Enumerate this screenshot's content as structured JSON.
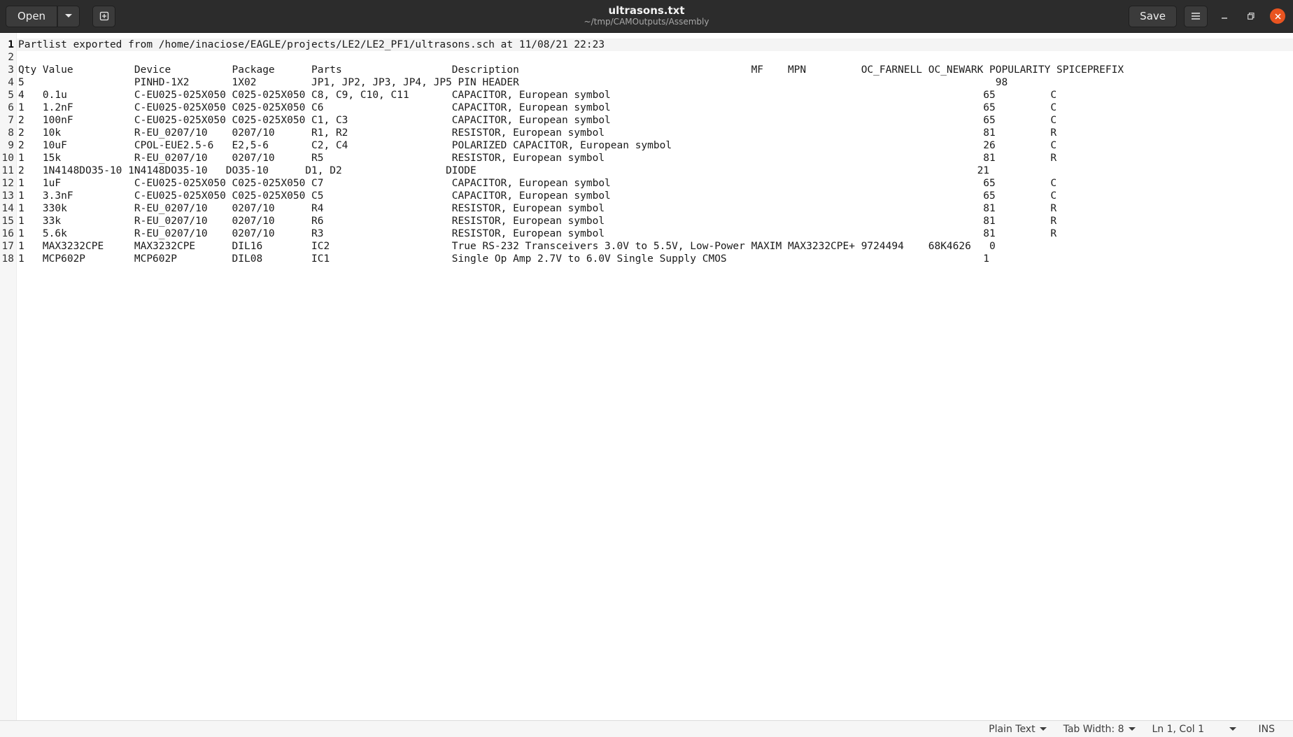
{
  "header": {
    "open_label": "Open",
    "save_label": "Save",
    "title": "ultrasons.txt",
    "subtitle": "~/tmp/CAMOutputs/Assembly"
  },
  "editor": {
    "lines": [
      "Partlist exported from /home/inaciose/EAGLE/projects/LE2/LE2_PF1/ultrasons.sch at 11/08/21 22:23",
      "",
      "Qty Value          Device          Package      Parts                  Description                                      MF    MPN         OC_FARNELL OC_NEWARK POPULARITY SPICEPREFIX",
      "5                  PINHD-1X2       1X02         JP1, JP2, JP3, JP4, JP5 PIN HEADER                                                                              98",
      "4   0.1u           C-EU025-025X050 C025-025X050 C8, C9, C10, C11       CAPACITOR, European symbol                                                             65         C",
      "1   1.2nF          C-EU025-025X050 C025-025X050 C6                     CAPACITOR, European symbol                                                             65         C",
      "2   100nF          C-EU025-025X050 C025-025X050 C1, C3                 CAPACITOR, European symbol                                                             65         C",
      "2   10k            R-EU_0207/10    0207/10      R1, R2                 RESISTOR, European symbol                                                              81         R",
      "2   10uF           CPOL-EUE2.5-6   E2,5-6       C2, C4                 POLARIZED CAPACITOR, European symbol                                                   26         C",
      "1   15k            R-EU_0207/10    0207/10      R5                     RESISTOR, European symbol                                                              81         R",
      "2   1N4148DO35-10 1N4148DO35-10   DO35-10      D1, D2                 DIODE                                                                                  21",
      "1   1uF            C-EU025-025X050 C025-025X050 C7                     CAPACITOR, European symbol                                                             65         C",
      "1   3.3nF          C-EU025-025X050 C025-025X050 C5                     CAPACITOR, European symbol                                                             65         C",
      "1   330k           R-EU_0207/10    0207/10      R4                     RESISTOR, European symbol                                                              81         R",
      "1   33k            R-EU_0207/10    0207/10      R6                     RESISTOR, European symbol                                                              81         R",
      "1   5.6k           R-EU_0207/10    0207/10      R3                     RESISTOR, European symbol                                                              81         R",
      "1   MAX3232CPE     MAX3232CPE      DIL16        IC2                    True RS-232 Transceivers 3.0V to 5.5V, Low-Power MAXIM MAX3232CPE+ 9724494    68K4626   0",
      "1   MCP602P        MCP602P         DIL08        IC1                    Single Op Amp 2.7V to 6.0V Single Supply CMOS                                          1"
    ],
    "line_numbers": [
      "1",
      "2",
      "3",
      "4",
      "5",
      "6",
      "7",
      "8",
      "9",
      "10",
      "11",
      "12",
      "13",
      "14",
      "15",
      "16",
      "17",
      "18"
    ]
  },
  "statusbar": {
    "language": "Plain Text",
    "tab_width": "Tab Width: 8",
    "position": "Ln 1, Col 1",
    "mode": "INS"
  },
  "colors": {
    "headerbar": "#2c2c2c",
    "close_button": "#e95420"
  }
}
